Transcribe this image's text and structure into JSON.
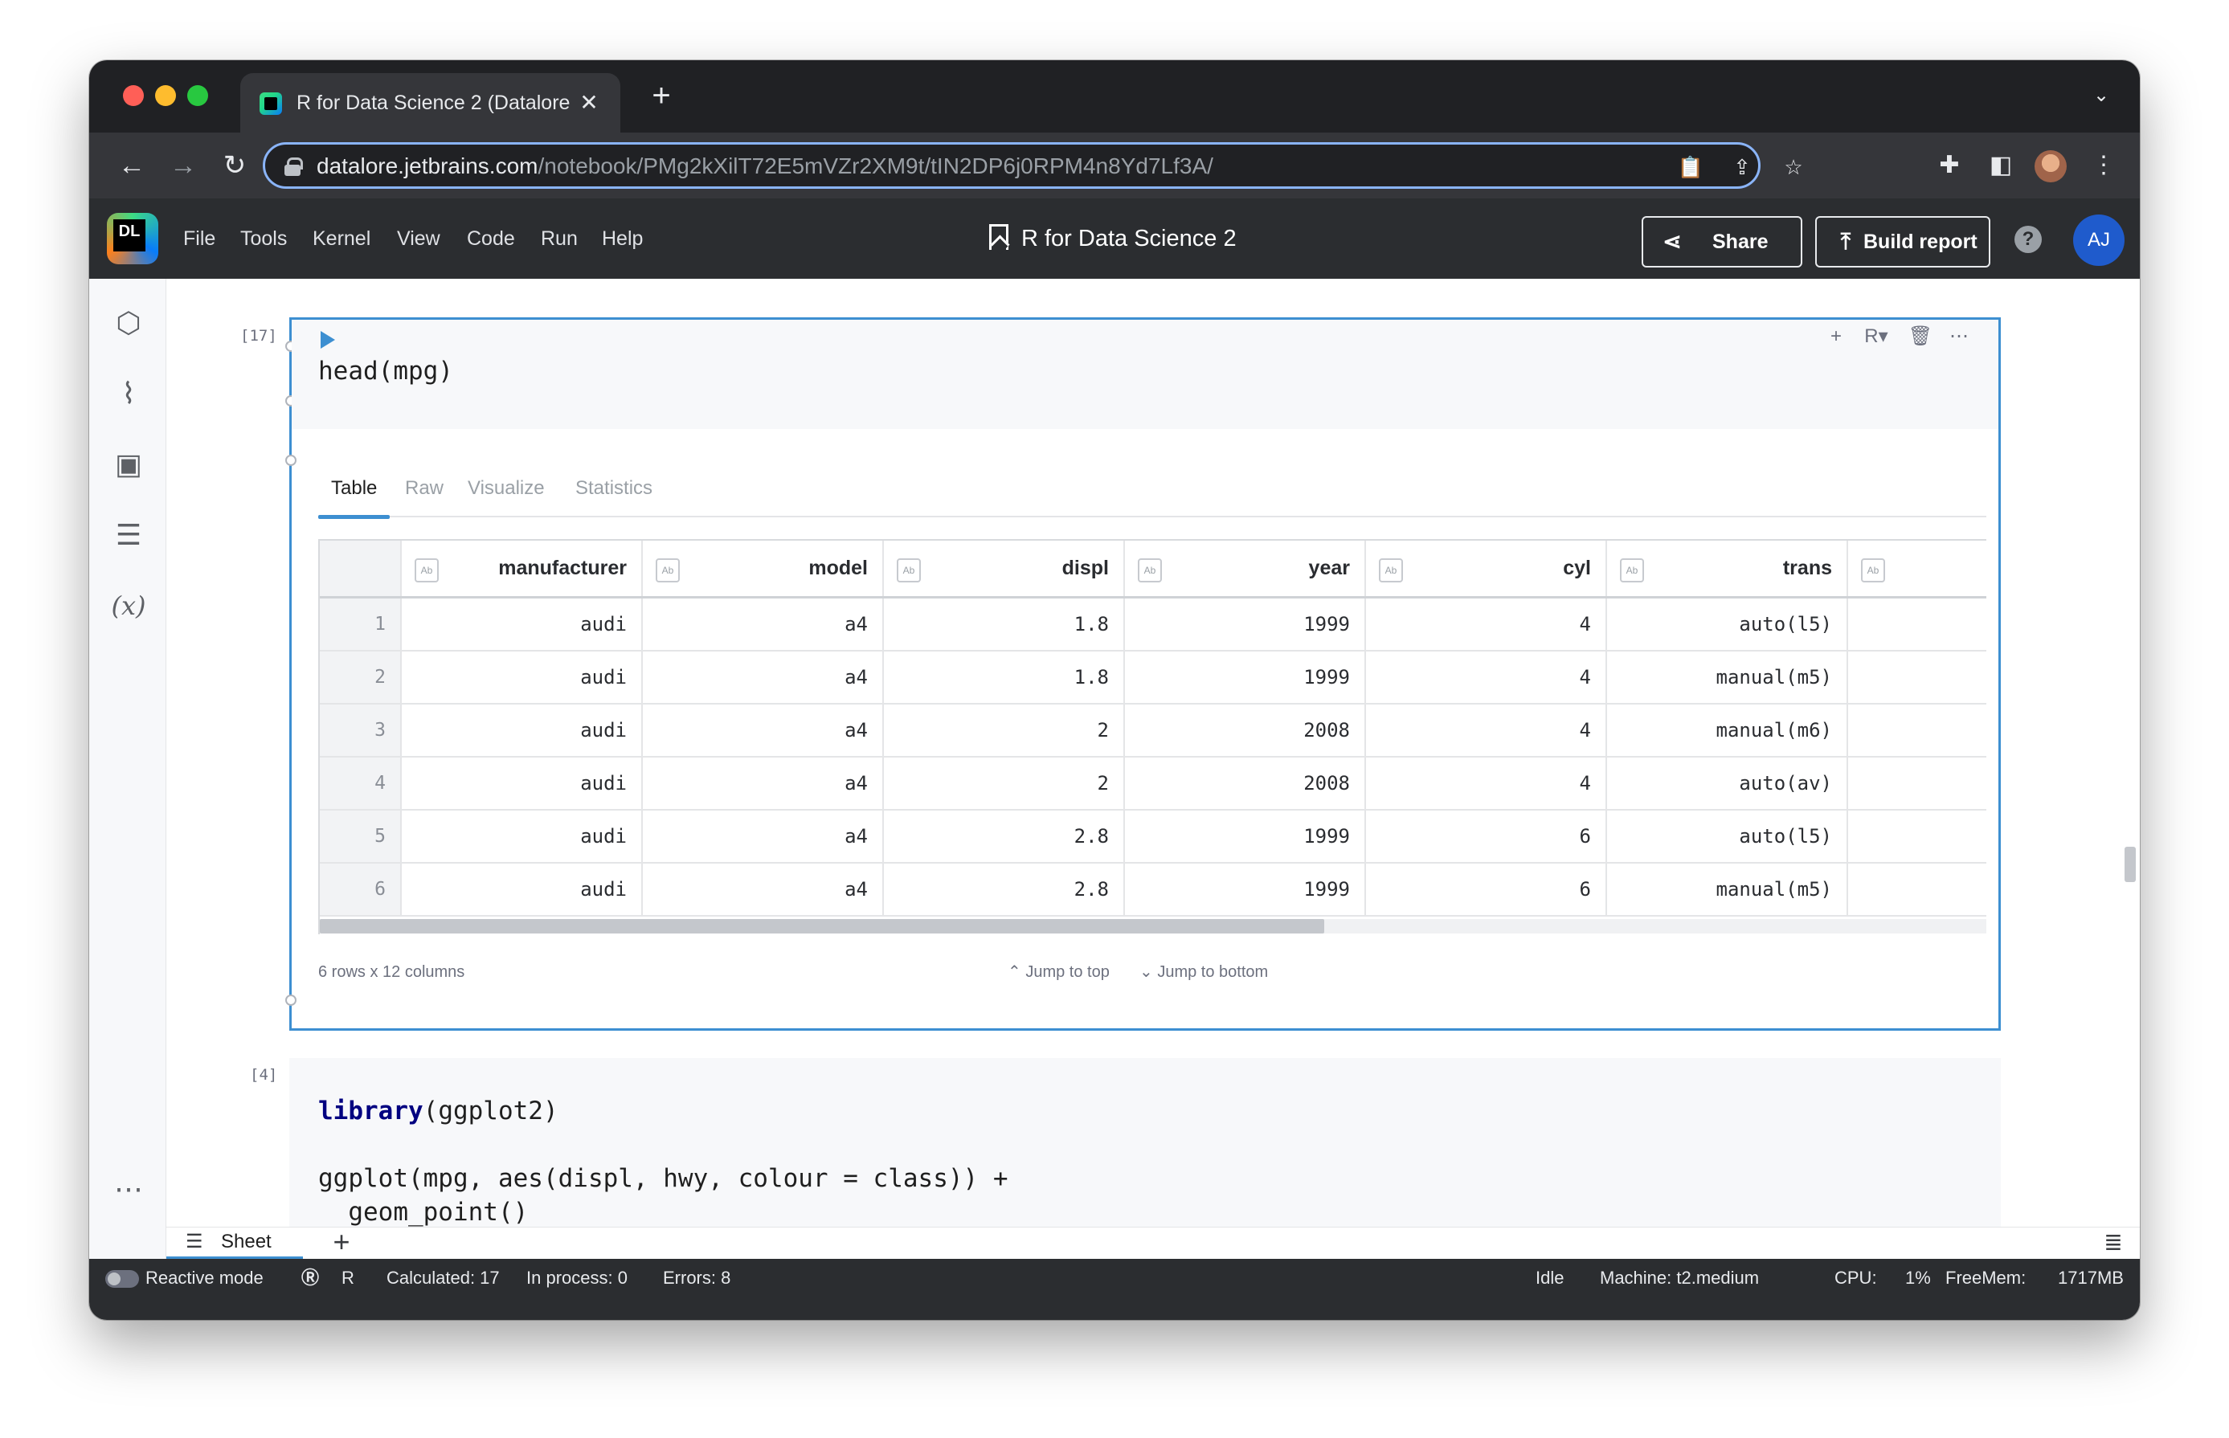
{
  "browser": {
    "tab_title": "R for Data Science 2 (Datalore",
    "tab_close": "✕",
    "new_tab": "+",
    "url_host": "datalore.jetbrains.com",
    "url_path": "/notebook/PMg2kXilT72E5mVZr2XM9t/tIN2DP6j0RPM4n8Yd7Lf3A/"
  },
  "app": {
    "logo_text": "DL",
    "menu": [
      "File",
      "Tools",
      "Kernel",
      "View",
      "Code",
      "Run",
      "Help"
    ],
    "doc_title": "R for Data Science 2",
    "share_label": "Share",
    "build_report_label": "Build report",
    "help": "?",
    "avatar": "AJ"
  },
  "cells": {
    "cell1": {
      "index": "[17]",
      "code": "head(mpg)",
      "output_tabs": [
        "Table",
        "Raw",
        "Visualize",
        "Statistics"
      ],
      "active_tab": "Table",
      "table": {
        "badge": "Ab",
        "columns": [
          "manufacturer",
          "model",
          "displ",
          "year",
          "cyl",
          "trans"
        ],
        "rows": [
          [
            "1",
            "audi",
            "a4",
            "1.8",
            "1999",
            "4",
            "auto(l5)"
          ],
          [
            "2",
            "audi",
            "a4",
            "1.8",
            "1999",
            "4",
            "manual(m5)"
          ],
          [
            "3",
            "audi",
            "a4",
            "2",
            "2008",
            "4",
            "manual(m6)"
          ],
          [
            "4",
            "audi",
            "a4",
            "2",
            "2008",
            "4",
            "auto(av)"
          ],
          [
            "5",
            "audi",
            "a4",
            "2.8",
            "1999",
            "6",
            "auto(l5)"
          ],
          [
            "6",
            "audi",
            "a4",
            "2.8",
            "1999",
            "6",
            "manual(m5)"
          ]
        ]
      },
      "footer": {
        "dims": "6 rows x 12 columns",
        "jump_top": "Jump to top",
        "jump_bottom": "Jump to bottom"
      }
    },
    "cell2": {
      "index": "[4]",
      "line1_kw": "library",
      "line1_rest": "(ggplot2)",
      "line2": "ggplot(mpg, aes(displ, hwy, colour = class)) +",
      "line3": "  geom_point()"
    }
  },
  "sheet": {
    "label": "Sheet",
    "add": "+"
  },
  "status": {
    "reactive_mode": "Reactive mode",
    "kernel": "R",
    "calculated": "Calculated: 17",
    "in_process": "In process: 0",
    "errors": "Errors: 8",
    "state": "Idle",
    "machine": "Machine: t2.medium",
    "cpu_label": "CPU:",
    "cpu_value": "1%",
    "freemem_label": "FreeMem:",
    "freemem_value": "1717MB"
  }
}
